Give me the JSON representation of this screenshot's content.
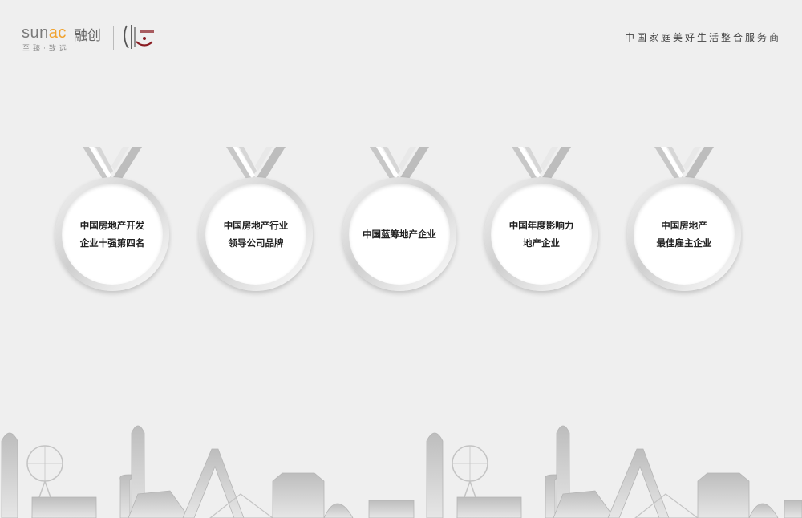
{
  "header": {
    "brand_latin_1": "sun",
    "brand_latin_2": "ac",
    "brand_cn": "融创",
    "slogan": "至臻·致远",
    "tagline": "中国家庭美好生活整合服务商"
  },
  "medals": [
    {
      "line1": "中国房地产开发",
      "line2": "企业十强第四名"
    },
    {
      "line1": "中国房地产行业",
      "line2": "领导公司品牌"
    },
    {
      "line1": "中国蓝筹地产企业",
      "line2": ""
    },
    {
      "line1": "中国年度影响力",
      "line2": "地产企业"
    },
    {
      "line1": "中国房地产",
      "line2": "最佳雇主企业"
    }
  ],
  "colors": {
    "background": "#efefef",
    "brand_orange": "#f0a22e",
    "seal_red": "#8a1c22",
    "skyline_gray": "#c9c9c9"
  }
}
